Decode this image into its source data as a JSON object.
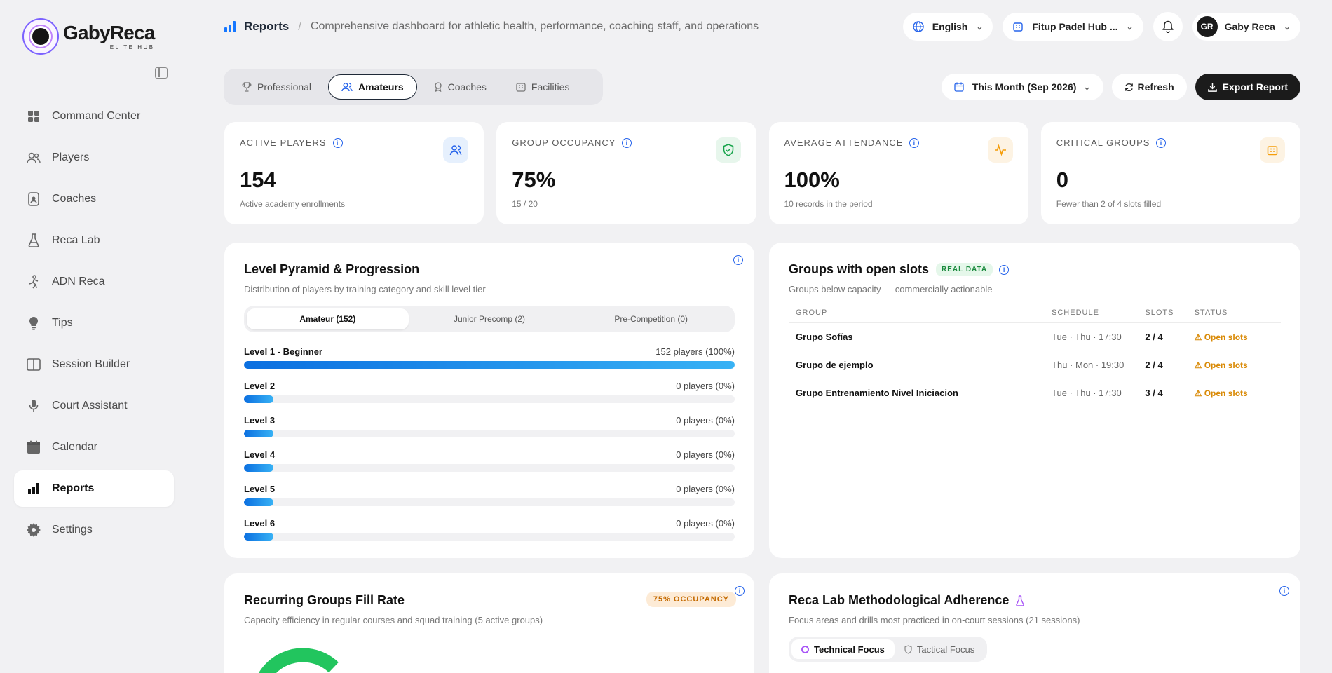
{
  "brand": {
    "name": "GabyReca",
    "tagline": "ELITE HUB"
  },
  "sidebar": {
    "items": [
      {
        "label": "Command Center",
        "icon": "grid-icon"
      },
      {
        "label": "Players",
        "icon": "users-icon"
      },
      {
        "label": "Coaches",
        "icon": "badge-icon"
      },
      {
        "label": "Reca Lab",
        "icon": "flask-icon"
      },
      {
        "label": "ADN Reca",
        "icon": "dna-icon"
      },
      {
        "label": "Tips",
        "icon": "lightbulb-icon"
      },
      {
        "label": "Session Builder",
        "icon": "book-icon"
      },
      {
        "label": "Court Assistant",
        "icon": "mic-icon"
      },
      {
        "label": "Calendar",
        "icon": "calendar-icon"
      },
      {
        "label": "Reports",
        "icon": "bar-chart-icon",
        "active": true
      },
      {
        "label": "Settings",
        "icon": "gear-icon"
      }
    ]
  },
  "header": {
    "title": "Reports",
    "separator": "/",
    "description": "Comprehensive dashboard for athletic health, performance, coaching staff, and operations",
    "language": "English",
    "venue": "Fitup Padel Hub ...",
    "user_initials": "GR",
    "user_name": "Gaby Reca"
  },
  "tabs": [
    {
      "label": "Professional"
    },
    {
      "label": "Amateurs",
      "active": true
    },
    {
      "label": "Coaches"
    },
    {
      "label": "Facilities"
    }
  ],
  "actions": {
    "period": "This Month (Sep 2026)",
    "refresh": "Refresh",
    "export": "Export Report"
  },
  "kpis": [
    {
      "label": "ACTIVE PLAYERS",
      "value": "154",
      "sub": "Active academy enrollments",
      "color": "#2563eb",
      "bg": "#e6f0fd"
    },
    {
      "label": "GROUP OCCUPANCY",
      "value": "75%",
      "sub": "15 / 20",
      "color": "#16a34a",
      "bg": "#e7f6ec"
    },
    {
      "label": "AVERAGE ATTENDANCE",
      "value": "100%",
      "sub": "10 records in the period",
      "color": "#f59e0b",
      "bg": "#fdf3e3"
    },
    {
      "label": "CRITICAL GROUPS",
      "value": "0",
      "sub": "Fewer than 2 of 4 slots filled",
      "color": "#f59e0b",
      "bg": "#fdf3e3"
    }
  ],
  "pyramid": {
    "title": "Level Pyramid & Progression",
    "subtitle": "Distribution of players by training category and skill level tier",
    "segments": [
      "Amateur (152)",
      "Junior Precomp (2)",
      "Pre-Competition (0)"
    ],
    "levels": [
      {
        "name": "Level 1 - Beginner",
        "count": "152 players (100%)",
        "percent": 100
      },
      {
        "name": "Level 2",
        "count": "0 players (0%)",
        "percent": 0
      },
      {
        "name": "Level 3",
        "count": "0 players (0%)",
        "percent": 0
      },
      {
        "name": "Level 4",
        "count": "0 players (0%)",
        "percent": 0
      },
      {
        "name": "Level 5",
        "count": "0 players (0%)",
        "percent": 0
      },
      {
        "name": "Level 6",
        "count": "0 players (0%)",
        "percent": 0
      }
    ]
  },
  "open_slots": {
    "title": "Groups with open slots",
    "badge": "REAL DATA",
    "subtitle": "Groups below capacity — commercially actionable",
    "columns": [
      "GROUP",
      "SCHEDULE",
      "SLOTS",
      "STATUS"
    ],
    "rows": [
      {
        "group": "Grupo Sofías",
        "schedule": "Tue · Thu · 17:30",
        "slots": "2 / 4",
        "status": "Open slots"
      },
      {
        "group": "Grupo de ejemplo",
        "schedule": "Thu · Mon · 19:30",
        "slots": "2 / 4",
        "status": "Open slots"
      },
      {
        "group": "Grupo Entrenamiento Nivel Iniciacion",
        "schedule": "Tue · Thu · 17:30",
        "slots": "3 / 4",
        "status": "Open slots"
      }
    ]
  },
  "fill_rate": {
    "title": "Recurring Groups Fill Rate",
    "badge": "75% OCCUPANCY",
    "subtitle": "Capacity efficiency in regular courses and squad training (5 active groups)"
  },
  "adherence": {
    "title": "Reca Lab Methodological Adherence",
    "subtitle": "Focus areas and drills most practiced in on-court sessions (21 sessions)",
    "tabs": [
      "Technical Focus",
      "Tactical Focus"
    ]
  }
}
